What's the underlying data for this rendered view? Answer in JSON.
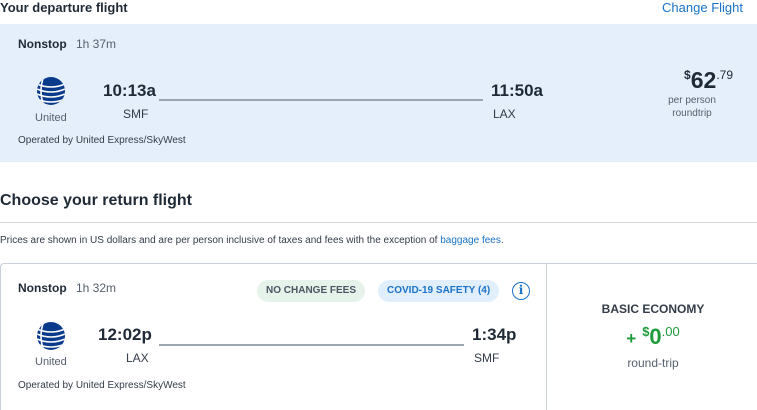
{
  "departure": {
    "heading": "Your departure flight",
    "change_link": "Change Flight",
    "stops": "Nonstop",
    "duration": "1h 37m",
    "airline": "United",
    "depart_time": "10:13a",
    "depart_code": "SMF",
    "arrive_time": "11:50a",
    "arrive_code": "LAX",
    "price_symbol": "$",
    "price_main": "62",
    "price_cents": ".79",
    "price_line1": "per person",
    "price_line2": "roundtrip",
    "operated_by": "Operated by United Express/SkyWest"
  },
  "return_section": {
    "heading": "Choose your return flight",
    "note_text": "Prices are shown in US dollars and are per person inclusive of taxes and fees with the exception of ",
    "note_link": "baggage fees",
    "note_end": "."
  },
  "return_flight": {
    "stops": "Nonstop",
    "duration": "1h 32m",
    "badge_no_change": "NO CHANGE FEES",
    "badge_covid": "COVID-19 SAFETY (4)",
    "info_icon": "i",
    "airline": "United",
    "depart_time": "12:02p",
    "depart_code": "LAX",
    "arrive_time": "1:34p",
    "arrive_code": "SMF",
    "operated_by": "Operated by United Express/SkyWest",
    "fare_class": "BASIC ECONOMY",
    "fare_plus": "+",
    "fare_symbol": "$",
    "fare_main": "0",
    "fare_cents": ".00",
    "fare_sub": "round-trip"
  },
  "colors": {
    "accent_blue": "#1a73c8",
    "card_bg": "#e4effb",
    "price_green": "#1e9c3c",
    "united_blue": "#0a3a8c"
  },
  "icons": {
    "airline_logo": "united-globe-icon",
    "info": "info-circle-icon"
  }
}
